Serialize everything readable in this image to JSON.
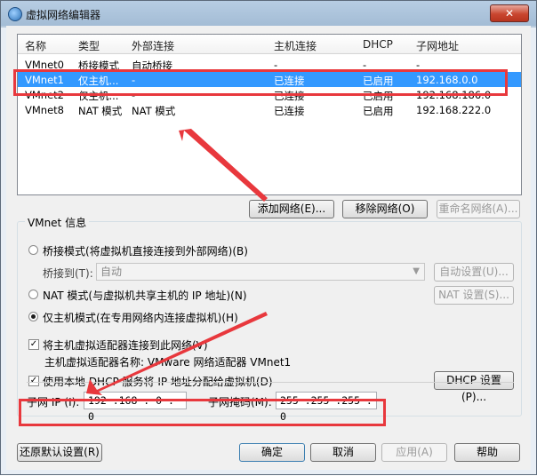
{
  "window": {
    "title": "虚拟网络编辑器",
    "close": "✕"
  },
  "network_list": {
    "columns": [
      "名称",
      "类型",
      "外部连接",
      "主机连接",
      "DHCP",
      "子网地址"
    ],
    "rows": [
      {
        "name": "VMnet0",
        "type": "桥接模式",
        "external": "自动桥接",
        "host": "-",
        "dhcp": "-",
        "subnet": "-"
      },
      {
        "name": "VMnet1",
        "type": "仅主机...",
        "external": "-",
        "host": "已连接",
        "dhcp": "已启用",
        "subnet": "192.168.0.0"
      },
      {
        "name": "VMnet2",
        "type": "仅主机...",
        "external": "-",
        "host": "已连接",
        "dhcp": "已启用",
        "subnet": "192.168.186.0"
      },
      {
        "name": "VMnet8",
        "type": "NAT 模式",
        "external": "NAT 模式",
        "host": "已连接",
        "dhcp": "已启用",
        "subnet": "192.168.222.0"
      }
    ],
    "selected_row": "VMnet1"
  },
  "list_buttons": {
    "add": "添加网络(E)...",
    "remove": "移除网络(O)",
    "rename": "重命名网络(A)..."
  },
  "vmnet_info": {
    "title": "VMnet 信息",
    "bridged_radio": "桥接模式(将虚拟机直接连接到外部网络)(B)",
    "bridged_to_label": "桥接到(T):",
    "bridged_to_value": "自动",
    "auto_settings": "自动设置(U)...",
    "nat_radio": "NAT 模式(与虚拟机共享主机的 IP 地址)(N)",
    "nat_settings": "NAT 设置(S)...",
    "hostonly_radio": "仅主机模式(在专用网络内连接虚拟机)(H)",
    "selected_mode": "hostonly",
    "connect_adapter_check": "将主机虚拟适配器连接到此网络(V)",
    "connect_adapter_checked": true,
    "adapter_name_text": "主机虚拟适配器名称: VMware 网络适配器 VMnet1",
    "dhcp_check": "使用本地 DHCP 服务将 IP 地址分配给虚拟机(D)",
    "dhcp_checked": true,
    "dhcp_settings": "DHCP 设置(P)...",
    "subnet_ip_label": "子网 IP (I):",
    "subnet_ip_value": "192 .168 . 0 . 0",
    "subnet_mask_label": "子网掩码(M):",
    "subnet_mask_value": "255 .255 .255 . 0"
  },
  "bottom_buttons": {
    "restore": "还原默认设置(R)",
    "ok": "确定",
    "cancel": "取消",
    "apply": "应用(A)",
    "help": "帮助"
  },
  "annotation_color": "#e8383d"
}
